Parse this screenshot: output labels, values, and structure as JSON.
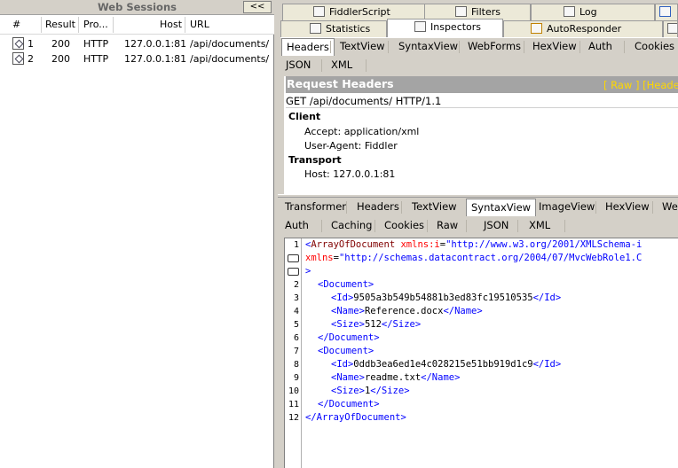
{
  "sessions": {
    "title": "Web Sessions",
    "collapse_label": "<<",
    "columns": [
      "#",
      "Result",
      "Pro...",
      "Host",
      "URL"
    ],
    "rows": [
      {
        "num": "1",
        "result": "200",
        "protocol": "HTTP",
        "host": "127.0.0.1:81",
        "url": "/api/documents/"
      },
      {
        "num": "2",
        "result": "200",
        "protocol": "HTTP",
        "host": "127.0.0.1:81",
        "url": "/api/documents/"
      }
    ]
  },
  "top_tabs": {
    "fiddlerscript": "FiddlerScript",
    "filters": "Filters",
    "log": "Log",
    "statistics": "Statistics",
    "inspectors": "Inspectors",
    "autoresponder": "AutoResponder"
  },
  "request_tabs": [
    "Headers",
    "TextView",
    "SyntaxView",
    "WebForms",
    "HexView",
    "Auth",
    "Cookies",
    "JSON",
    "XML"
  ],
  "request": {
    "title": "Request Headers",
    "links": "[ Raw ]    [Heade",
    "line": "GET /api/documents/ HTTP/1.1",
    "groups": [
      {
        "name": "Client",
        "items": [
          "Accept: application/xml",
          "User-Agent: Fiddler"
        ]
      },
      {
        "name": "Transport",
        "items": [
          "Host: 127.0.0.1:81"
        ]
      }
    ]
  },
  "response_tabs_row1": [
    "Transformer",
    "Headers",
    "TextView",
    "SyntaxView",
    "ImageView",
    "HexView",
    "Web"
  ],
  "response_tabs_row2": [
    "Auth",
    "Caching",
    "Cookies",
    "Raw",
    "JSON",
    "XML"
  ],
  "code": {
    "line_numbers": [
      "1",
      "2",
      "3",
      "4",
      "5",
      "6",
      "7",
      "8",
      "9",
      "10",
      "11",
      "12"
    ],
    "l1_open": "<",
    "l1_tag": "ArrayOfDocument",
    "l1_attr": "xmlns:i",
    "l1_eq": "=",
    "l1_val": "\"http://www.w3.org/2001/XMLSchema-i",
    "l1b_attr": "xmlns",
    "l1b_val": "\"http://schemas.datacontract.org/2004/07/MvcWebRole1.C",
    "l1c": ">",
    "doc_open": "<Document>",
    "doc_close": "</Document>",
    "id1_open": "<Id>",
    "id1_val": "9505a3b549b54881b3ed83fc19510535",
    "id1_close": "</Id>",
    "name1_open": "<Name>",
    "name1_val": "Reference.docx",
    "name1_close": "</Name>",
    "size1_open": "<Size>",
    "size1_val": "512",
    "size1_close": "</Size>",
    "id2_open": "<Id>",
    "id2_val": "0ddb3ea6ed1e4c028215e51bb919d1c9",
    "id2_close": "</Id>",
    "name2_open": "<Name>",
    "name2_val": "readme.txt",
    "name2_close": "</Name>",
    "size2_open": "<Size>",
    "size2_val": "1",
    "size2_close": "</Size>",
    "close_root": "</ArrayOfDocument>"
  },
  "colors": {
    "tag": "#0000ff",
    "tag_name": "#800000",
    "attr": "#ff0000",
    "header_bg": "#a4a4a4",
    "links": "#ffd700"
  }
}
